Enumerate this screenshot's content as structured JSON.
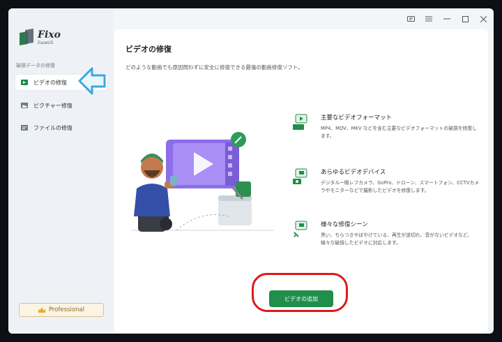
{
  "window": {
    "controls": [
      {
        "name": "feedback-icon",
        "glyph": "⎚"
      },
      {
        "name": "menu-icon",
        "glyph": "≡"
      },
      {
        "name": "minimize-icon",
        "glyph": "−"
      },
      {
        "name": "maximize-icon",
        "glyph": "☐"
      },
      {
        "name": "close-icon",
        "glyph": "✕"
      }
    ]
  },
  "sidebar": {
    "logo_name": "Fixo",
    "logo_sub": "EaseUS",
    "section_label": "破損データの修復",
    "items": [
      {
        "label": "ビデオの修復",
        "icon": "video-icon",
        "active": true
      },
      {
        "label": "ピクチャー修復",
        "icon": "picture-icon",
        "active": false
      },
      {
        "label": "ファイルの修復",
        "icon": "file-icon",
        "active": false
      }
    ],
    "pro_label": "Professional"
  },
  "main": {
    "title": "ビデオの修復",
    "description": "どのような動画でも原因問わずに安全に修復できる最強の動画修復ソフト。",
    "features": [
      {
        "title": "主要なビデオフォーマット",
        "description": "MP4、MOV、MKV などを含む主要なビデオフォーマットの破損を修復します。",
        "icon": "video-format-icon"
      },
      {
        "title": "あらゆるビデオデバイス",
        "description": "デジタル一眼レフカメラ、GoPro、ドローン、スマートフォン、CCTVカメラやモニターなどで撮影したビデオを修復します。",
        "icon": "video-device-icon"
      },
      {
        "title": "様々な修復シーン",
        "description": "黒い、ちらつきやぼやけている、再生が途切れ、音がないビデオなど、様々な破損したビデオに対応します。",
        "icon": "repair-scene-icon"
      }
    ],
    "add_button": "ビデオの追加"
  },
  "colors": {
    "accent": "#1f8f4a",
    "highlight_arrow": "#3aa8e0",
    "annotation_red": "#e01818"
  }
}
